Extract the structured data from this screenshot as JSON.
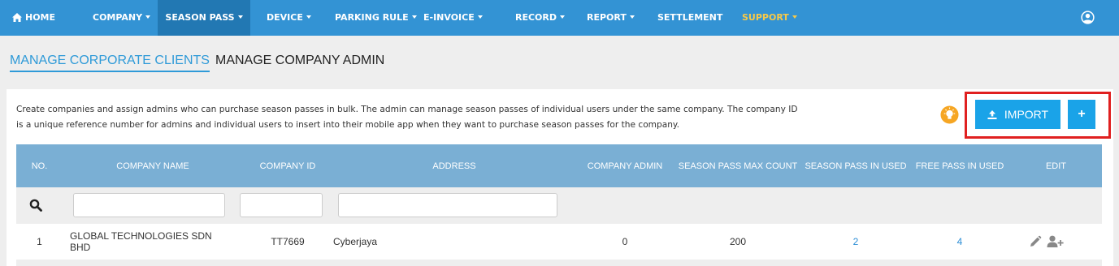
{
  "nav": {
    "items": [
      {
        "label": "HOME"
      },
      {
        "label": "COMPANY"
      },
      {
        "label": "SEASON PASS"
      },
      {
        "label": "DEVICE"
      },
      {
        "label": "PARKING RULE"
      },
      {
        "label": "E-INVOICE"
      },
      {
        "label": "RECORD"
      },
      {
        "label": "REPORT"
      },
      {
        "label": "SETTLEMENT"
      },
      {
        "label": "SUPPORT"
      }
    ],
    "active": "SEASON PASS",
    "colors": {
      "bar": "#3393d4",
      "active": "#2278b3",
      "support": "#f7c948"
    }
  },
  "tabs": [
    {
      "label": "MANAGE CORPORATE CLIENTS"
    },
    {
      "label": "MANAGE COMPANY ADMIN"
    }
  ],
  "description": "Create companies and assign admins who can purchase season passes in bulk. The admin can manage season passes of individual users under the same company. The company ID is a unique reference number for admins and individual users to insert into their mobile app when they want to purchase season passes for the company.",
  "buttons": {
    "import_label": "IMPORT",
    "add_label": "+"
  },
  "table": {
    "headers": [
      "NO.",
      "COMPANY NAME",
      "COMPANY ID",
      "ADDRESS",
      "COMPANY ADMIN",
      "SEASON PASS MAX COUNT",
      "SEASON PASS IN USED",
      "FREE PASS IN USED",
      "EDIT"
    ],
    "rows": [
      {
        "no": "1",
        "company_name": "GLOBAL TECHNOLOGIES SDN BHD",
        "company_id": "TT7669",
        "address": "Cyberjaya",
        "company_admin": "0",
        "season_pass_max_count": "200",
        "season_pass_in_used": "2",
        "free_pass_in_used": "4"
      }
    ]
  },
  "icons": [
    "home-icon",
    "user-circle-icon",
    "lightbulb-icon",
    "upload-icon",
    "plus-icon",
    "search-icon",
    "pencil-icon",
    "add-user-icon"
  ],
  "accent_color": "#1aa3e8",
  "highlight_color": "#e02020"
}
